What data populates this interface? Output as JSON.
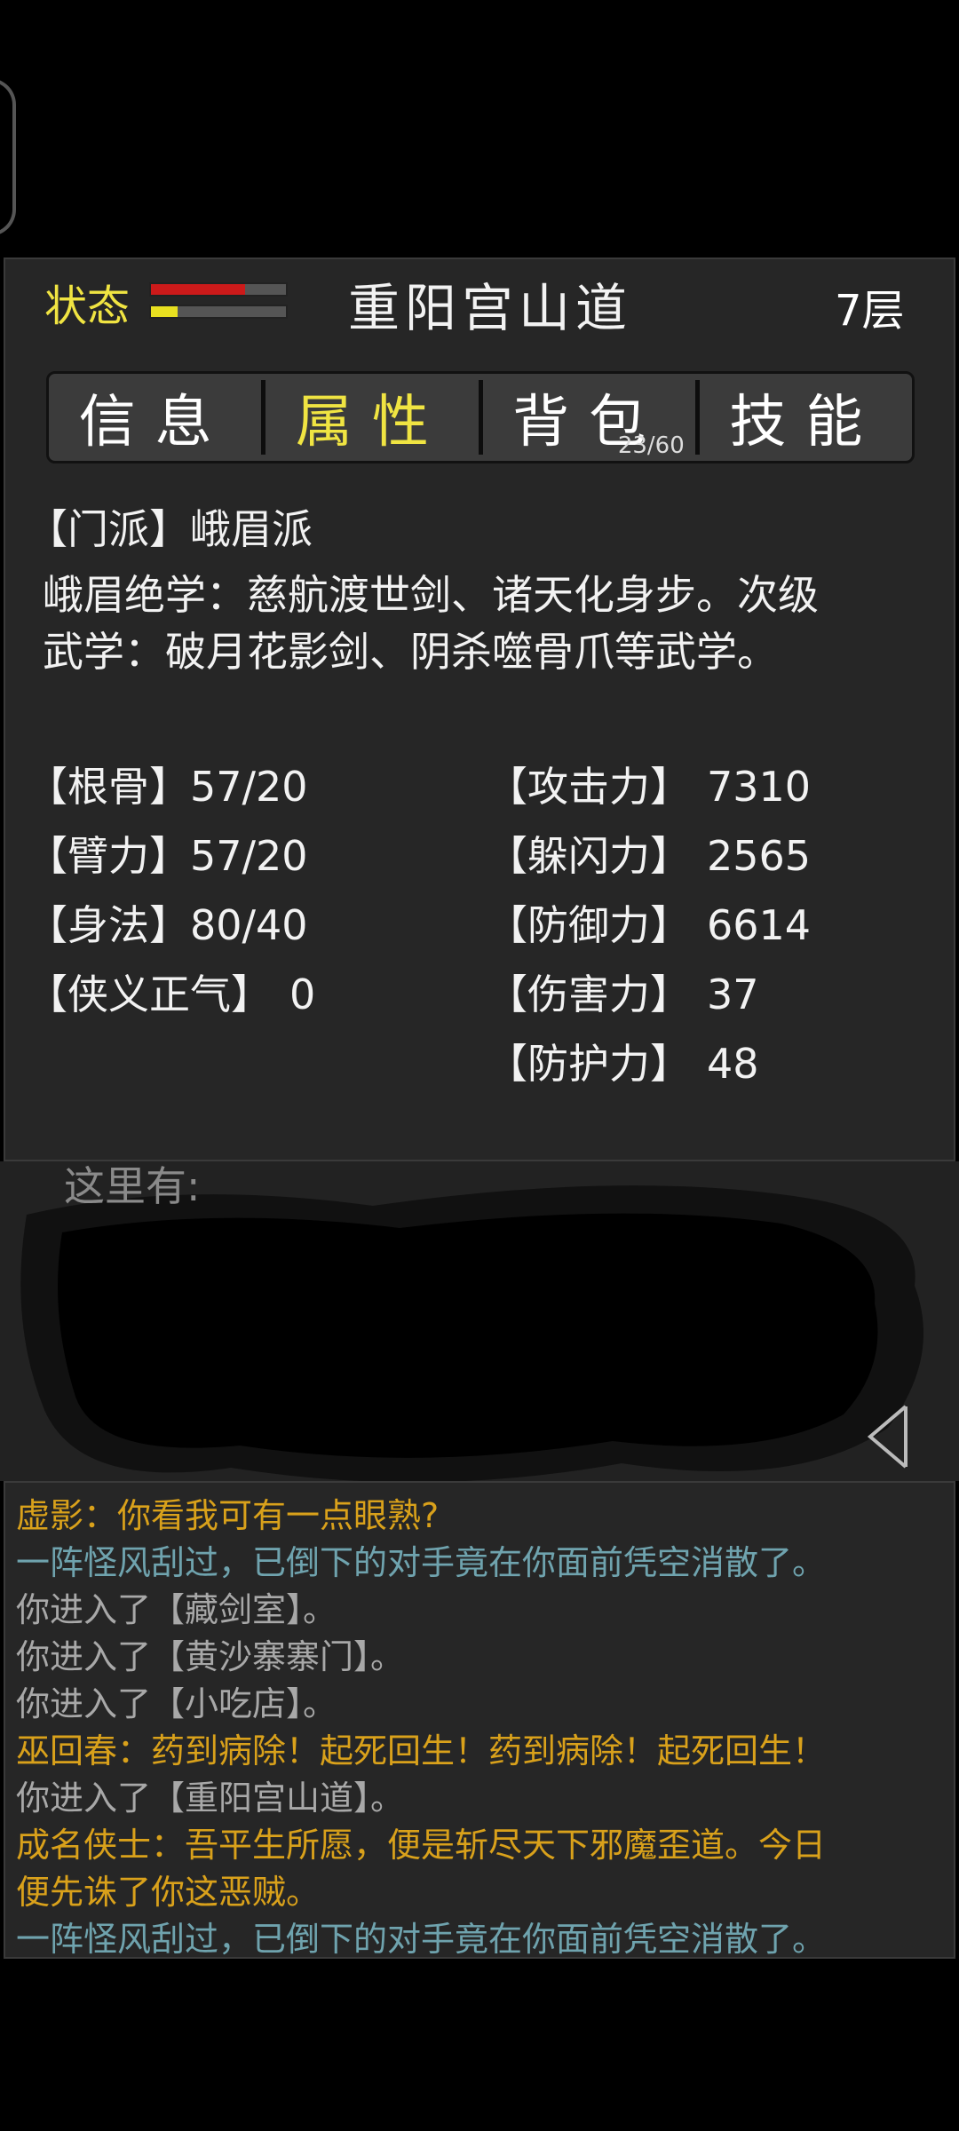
{
  "header": {
    "status_label": "状态",
    "location": "重阳宫山道",
    "floor": "7层",
    "hp_fraction": 0.7,
    "mp_fraction": 0.2,
    "colors": {
      "hp": "#cc1a1a",
      "mp": "#e8e020",
      "accent": "#f0e442"
    }
  },
  "tabs": [
    {
      "label": "信息",
      "active": false
    },
    {
      "label": "属性",
      "active": true
    },
    {
      "label": "背包",
      "active": false,
      "count": "23/60"
    },
    {
      "label": "技能",
      "active": false
    }
  ],
  "attributes": {
    "sect_line": "【门派】峨眉派",
    "description": "峨眉绝学：慈航渡世剑、诸天化身步。次级武学：破月花影剑、阴杀噬骨爪等武学。",
    "left_stats": [
      {
        "label": "【根骨】",
        "value": "57/20"
      },
      {
        "label": "【臂力】",
        "value": "57/20"
      },
      {
        "label": "【身法】",
        "value": "80/40"
      },
      {
        "label": "【侠义正气】",
        "value": "0"
      }
    ],
    "right_stats": [
      {
        "label": "【攻击力】",
        "value": "7310"
      },
      {
        "label": "【躲闪力】",
        "value": "2565"
      },
      {
        "label": "【防御力】",
        "value": "6614"
      },
      {
        "label": "【伤害力】",
        "value": "37"
      },
      {
        "label": "【防护力】",
        "value": "48"
      }
    ]
  },
  "scene": {
    "here_label": "这里有:"
  },
  "log": [
    {
      "text": "虚影：你看我可有一点眼熟?",
      "color": "#d9a11b"
    },
    {
      "text": "一阵怪风刮过，已倒下的对手竟在你面前凭空消散了。",
      "color": "#6fa3ae"
    },
    {
      "text": "你进入了【藏剑室】。",
      "color": "#a8a8a8"
    },
    {
      "text": "你进入了【黄沙寨寨门】。",
      "color": "#a8a8a8"
    },
    {
      "text": "你进入了【小吃店】。",
      "color": "#a8a8a8"
    },
    {
      "text": "巫回春：药到病除！起死回生！药到病除！起死回生！",
      "color": "#d9a11b"
    },
    {
      "text": "你进入了【重阳宫山道】。",
      "color": "#a8a8a8"
    },
    {
      "text": "成名侠士：吾平生所愿，便是斩尽天下邪魔歪道。今日",
      "color": "#d9a11b"
    },
    {
      "text": "便先诛了你这恶贼。",
      "color": "#d9a11b"
    },
    {
      "text": "一阵怪风刮过，已倒下的对手竟在你面前凭空消散了。",
      "color": "#6fa3ae"
    }
  ]
}
